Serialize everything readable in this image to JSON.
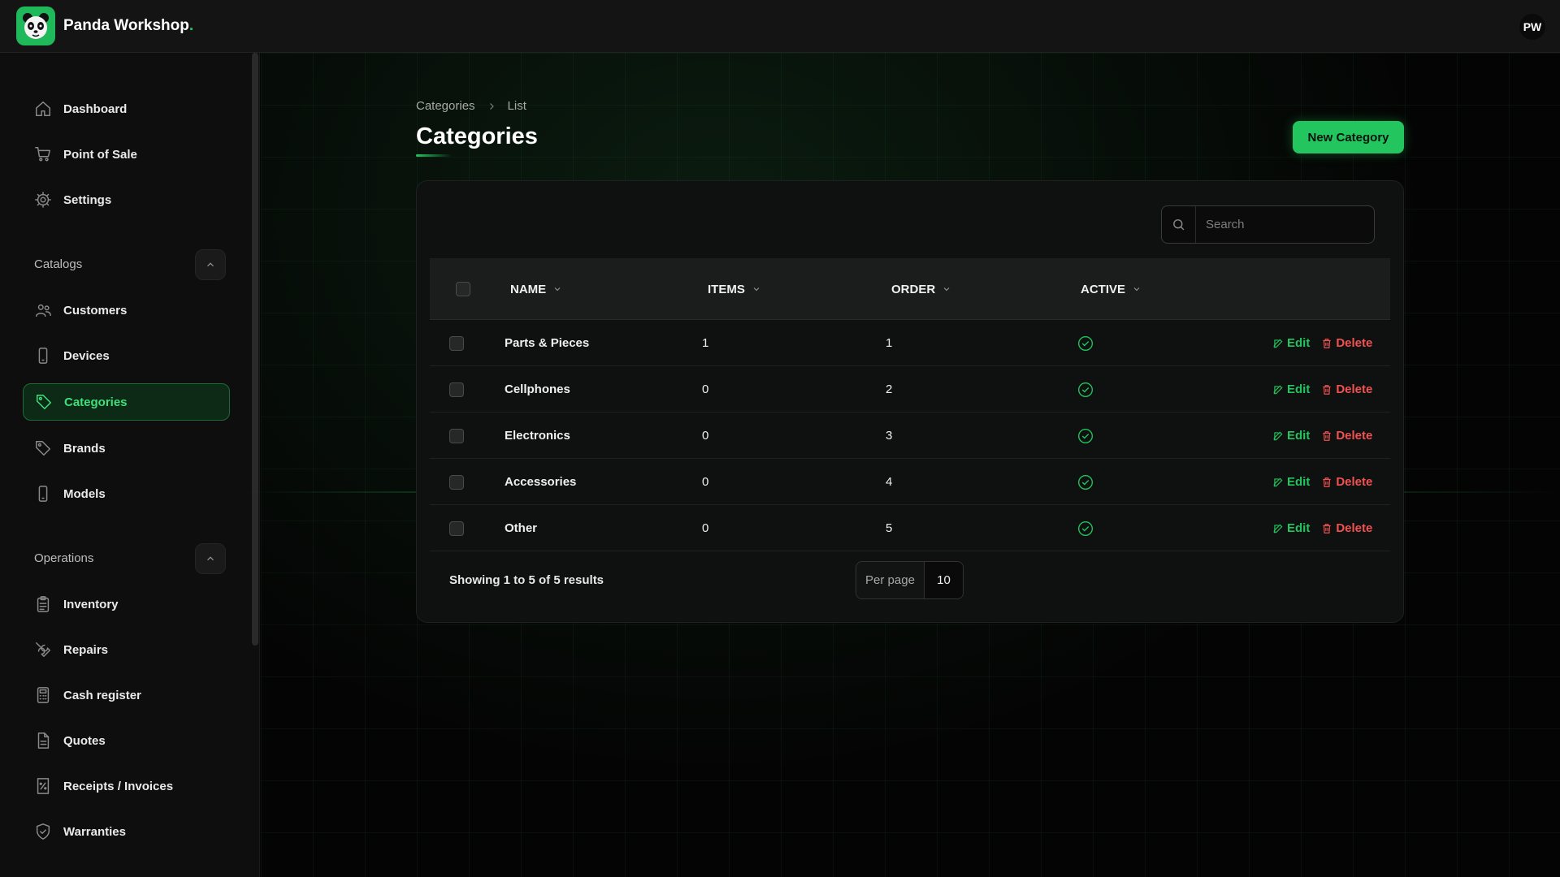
{
  "app": {
    "name": "Panda Workshop",
    "name_suffix": ".",
    "user_initials": "PW"
  },
  "sidebar": {
    "top_items": [
      {
        "label": "Dashboard",
        "icon": "home-icon"
      },
      {
        "label": "Point of Sale",
        "icon": "cart-icon"
      },
      {
        "label": "Settings",
        "icon": "gear-icon"
      }
    ],
    "groups": [
      {
        "label": "Catalogs",
        "items": [
          {
            "label": "Customers",
            "icon": "users-icon"
          },
          {
            "label": "Devices",
            "icon": "phone-icon"
          },
          {
            "label": "Categories",
            "icon": "tag-icon",
            "active": true
          },
          {
            "label": "Brands",
            "icon": "tag-icon"
          },
          {
            "label": "Models",
            "icon": "phone-icon"
          }
        ]
      },
      {
        "label": "Operations",
        "items": [
          {
            "label": "Inventory",
            "icon": "clipboard-icon"
          },
          {
            "label": "Repairs",
            "icon": "tools-icon"
          },
          {
            "label": "Cash register",
            "icon": "calculator-icon"
          },
          {
            "label": "Quotes",
            "icon": "document-icon"
          },
          {
            "label": "Receipts / Invoices",
            "icon": "receipt-icon"
          },
          {
            "label": "Warranties",
            "icon": "shield-check-icon"
          }
        ]
      }
    ]
  },
  "breadcrumb": [
    "Categories",
    "List"
  ],
  "page": {
    "title": "Categories",
    "new_button": "New Category"
  },
  "search": {
    "placeholder": "Search",
    "value": ""
  },
  "table": {
    "columns": [
      "NAME",
      "ITEMS",
      "ORDER",
      "ACTIVE"
    ],
    "rows": [
      {
        "name": "Parts & Pieces",
        "items": "1",
        "order": "1",
        "active": true
      },
      {
        "name": "Cellphones",
        "items": "0",
        "order": "2",
        "active": true
      },
      {
        "name": "Electronics",
        "items": "0",
        "order": "3",
        "active": true
      },
      {
        "name": "Accessories",
        "items": "0",
        "order": "4",
        "active": true
      },
      {
        "name": "Other",
        "items": "0",
        "order": "5",
        "active": true
      }
    ],
    "actions": {
      "edit": "Edit",
      "delete": "Delete"
    },
    "footer": {
      "summary": "Showing 1 to 5 of 5 results",
      "per_page_label": "Per page",
      "per_page_value": "10"
    }
  },
  "colors": {
    "accent": "#22c55e",
    "danger": "#f05252",
    "background": "#050505"
  }
}
